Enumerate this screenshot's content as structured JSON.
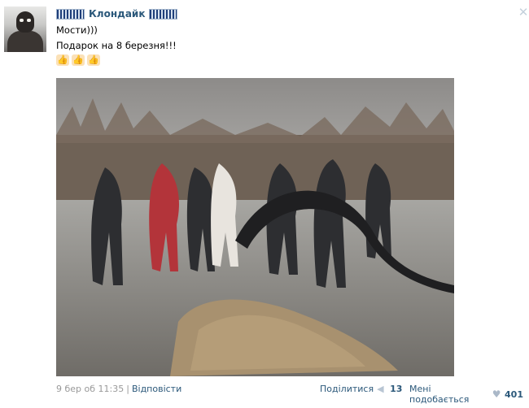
{
  "post": {
    "author": "Клондайк",
    "line1": "Мости)))",
    "line2": "Подарок на 8 березня!!!",
    "emoji": [
      "thumbs-up-icon",
      "thumbs-up-icon",
      "thumbs-up-icon"
    ]
  },
  "footer": {
    "date": "9 бер об 11:35",
    "separator": "|",
    "reply": "Відповісти",
    "share_label": "Поділитися",
    "share_count": "13",
    "like_label": "Мені подобається",
    "like_count": "401"
  },
  "colors": {
    "link": "#2b587a",
    "muted": "#999999"
  }
}
